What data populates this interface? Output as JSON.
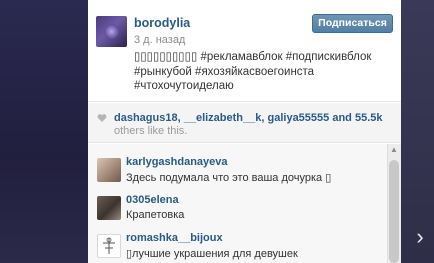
{
  "post": {
    "username": "borodylia",
    "timestamp": "3 д. назад",
    "follow_label": "Подписаться",
    "caption": "▯▯▯▯▯▯▯▯▯▯ #рекламавблок #подпискивблок #рынкубой #яхозяйкасвоегоинста #чтохочутоиделаю"
  },
  "likes": {
    "names": [
      "dashagus18",
      "__elizabeth__k",
      "galiya55555"
    ],
    "count": "55.5k",
    "others_text": "others like this."
  },
  "comments": [
    {
      "username": "karlygashdanayeva",
      "text": "Здесь подумала что это ваша дочурка ▯"
    },
    {
      "username": "0305elena",
      "text": "Крапетовка"
    },
    {
      "username": "romashka__bijoux",
      "text": "▯лучшие украшения для девушек"
    }
  ],
  "nav": {
    "next_glyph": "›"
  },
  "colors": {
    "link": "#2a5a85",
    "follow_button": "#517fa4"
  }
}
